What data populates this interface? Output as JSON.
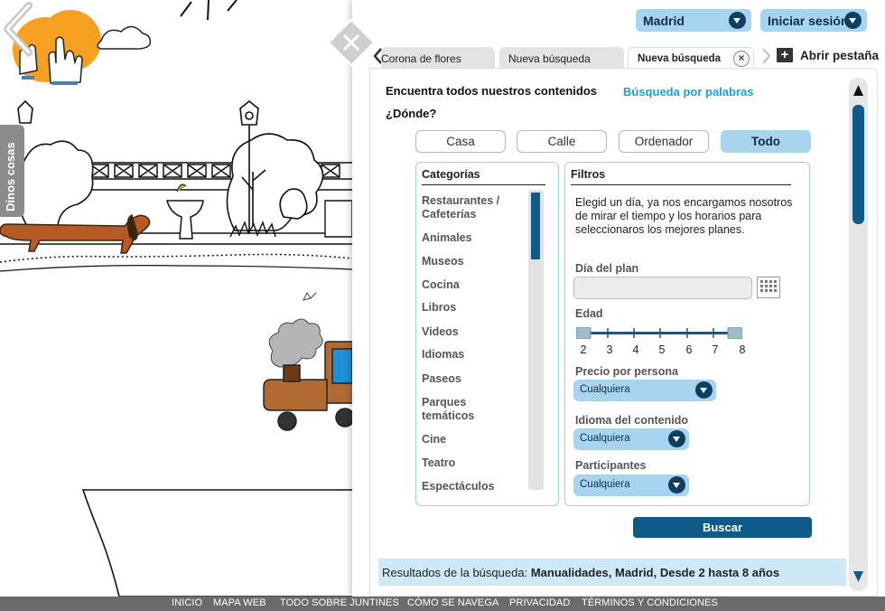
{
  "left_panel": {
    "side_tab_label": "Dinos cosas"
  },
  "header": {
    "city_selector": "Madrid",
    "login_button": "Iniciar sesión"
  },
  "tabs": {
    "items": [
      {
        "label": "Corona de flores",
        "active": false
      },
      {
        "label": "Nueva búsqueda",
        "active": false
      },
      {
        "label": "Nueva búsqueda",
        "active": true
      }
    ],
    "close_symbol": "×",
    "add_tab_symbol": "+",
    "add_tab_label": "Abrir pestaña"
  },
  "search": {
    "heading": "Encuentra todos nuestros contenidos",
    "keyword_link": "Búsqueda por palabras",
    "where_label": "¿Dónde?",
    "locations": [
      "Casa",
      "Calle",
      "Ordenador",
      "Todo"
    ],
    "selected_location": "Todo",
    "categories_title": "Categorías",
    "categories": [
      "Restaurantes / Cafeterías",
      "Animales",
      "Museos",
      "Cocina",
      "Libros",
      "Videos",
      "Idiomas",
      "Paseos",
      "Parques temáticos",
      "Cine",
      "Teatro",
      "Espectáculos"
    ],
    "categories_scroll_position": 0.0,
    "filters_title": "Filtros",
    "filters_description": "Elegid un día, ya nos encargamos nosotros de mirar el tiempo y los horarios para seleccionaros los mejores planes.",
    "date_label": "Día del plan",
    "date_value": "",
    "age_label": "Edad",
    "age_ticks": [
      "2",
      "3",
      "4",
      "5",
      "6",
      "7",
      "8"
    ],
    "age_range": [
      2,
      8
    ],
    "price_label": "Precio por persona",
    "price_value": "Cualquiera",
    "language_label": "Idioma del contenido",
    "language_value": "Cualquiera",
    "participants_label": "Participantes",
    "participants_value": "Cualquiera",
    "search_button": "Buscar",
    "results_prefix": "Resultados de la búsqueda:",
    "results_query": "Manualidades, Madrid, Desde 2 hasta 8 años"
  },
  "footer": {
    "links": [
      "INICIO",
      "MAPA WEB",
      "TODO SOBRE JUNTINES",
      "CÓMO SE NAVEGA",
      "PRIVACIDAD",
      "TÉRMINOS Y CONDICIONES"
    ]
  },
  "colors": {
    "accent_light": "#a9d4ef",
    "accent_dark": "#0f5a88",
    "link": "#1aa0dc",
    "footer": "#6b6b6b",
    "logo_orange": "#f5a020"
  }
}
